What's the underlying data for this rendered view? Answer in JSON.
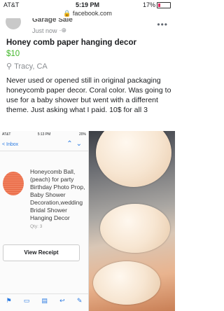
{
  "status_bar": {
    "carrier": "AT&T",
    "time": "5:19 PM",
    "battery": "17%"
  },
  "url_bar": {
    "url": "facebook.com"
  },
  "post": {
    "group_name": "Garage Sale",
    "time": "Just now",
    "listing_title": "Honey comb paper hanging decor",
    "price": "$10",
    "location": "Tracy, CA",
    "description": "Never used or opened still in original packaging honeycomb paper decor. Coral color. Was going to use for a baby shower but went with a different theme. Just asking what I paid. 10$ for all 3"
  },
  "embedded_screenshot": {
    "status": {
      "carrier": "AT&T",
      "time": "5:13 PM",
      "battery": "20%"
    },
    "back_label": "Inbox",
    "product_description": "Honeycomb Ball, (peach) for party Birthday Photo Prop, Baby Shower Decoration,wedding Bridal Shower Hanging Decor",
    "quantity": "Qty: 3",
    "receipt_button": "View Receipt"
  },
  "colors": {
    "price_green": "#42b72a",
    "product_coral": "#f0805e",
    "link_blue": "#2a7ae2"
  }
}
